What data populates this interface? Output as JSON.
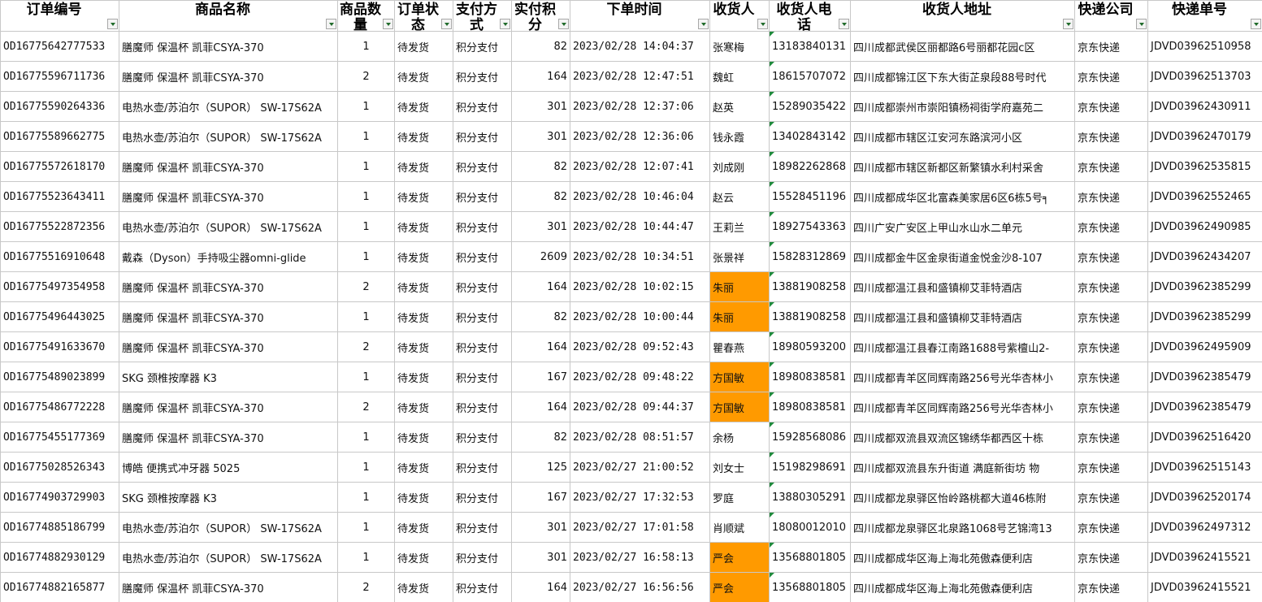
{
  "headers": [
    {
      "label": "订单编号"
    },
    {
      "label": "商品名称"
    },
    {
      "label": "商品数量"
    },
    {
      "label": "订单状态"
    },
    {
      "label": "支付方式"
    },
    {
      "label": "实付积分"
    },
    {
      "label": "下单时间"
    },
    {
      "label": "收货人"
    },
    {
      "label": "收货人电话"
    },
    {
      "label": "收货人地址"
    },
    {
      "label": "快递公司"
    },
    {
      "label": "快递单号"
    }
  ],
  "rows": [
    {
      "order_id": "OD16775642777533",
      "product": "膳魔师 保温杯 凯菲CSYA-370",
      "qty": "1",
      "status": "待发货",
      "pay": "积分支付",
      "points": "82",
      "time": "2023/02/28 14:04:37",
      "name": "张寒梅",
      "phone": "13183840131",
      "addr": "四川成都武侯区丽都路6号丽都花园c区",
      "courier": "京东快递",
      "tracking": "JDVD03962510958",
      "name_highlight": false
    },
    {
      "order_id": "OD16775596711736",
      "product": "膳魔师 保温杯 凯菲CSYA-370",
      "qty": "2",
      "status": "待发货",
      "pay": "积分支付",
      "points": "164",
      "time": "2023/02/28 12:47:51",
      "name": "魏虹",
      "phone": "18615707072",
      "addr": "四川成都锦江区下东大街芷泉段88号时代",
      "courier": "京东快递",
      "tracking": "JDVD03962513703",
      "name_highlight": false
    },
    {
      "order_id": "OD16775590264336",
      "product": "电热水壶/苏泊尔（SUPOR） SW-17S62A",
      "qty": "1",
      "status": "待发货",
      "pay": "积分支付",
      "points": "301",
      "time": "2023/02/28 12:37:06",
      "name": "赵英",
      "phone": "15289035422",
      "addr": "四川成都崇州市崇阳镇杨祠街学府嘉苑二",
      "courier": "京东快递",
      "tracking": "JDVD03962430911",
      "name_highlight": false
    },
    {
      "order_id": "OD16775589662775",
      "product": "电热水壶/苏泊尔（SUPOR） SW-17S62A",
      "qty": "1",
      "status": "待发货",
      "pay": "积分支付",
      "points": "301",
      "time": "2023/02/28 12:36:06",
      "name": "钱永霞",
      "phone": "13402843142",
      "addr": "四川成都市辖区江安河东路滨河小区",
      "courier": "京东快递",
      "tracking": "JDVD03962470179",
      "name_highlight": false
    },
    {
      "order_id": "OD16775572618170",
      "product": "膳魔师 保温杯 凯菲CSYA-370",
      "qty": "1",
      "status": "待发货",
      "pay": "积分支付",
      "points": "82",
      "time": "2023/02/28 12:07:41",
      "name": "刘成刚",
      "phone": "18982262868",
      "addr": "四川成都市辖区新都区新繁镇水利村采舍",
      "courier": "京东快递",
      "tracking": "JDVD03962535815",
      "name_highlight": false
    },
    {
      "order_id": "OD16775523643411",
      "product": "膳魔师 保温杯 凯菲CSYA-370",
      "qty": "1",
      "status": "待发货",
      "pay": "积分支付",
      "points": "82",
      "time": "2023/02/28 10:46:04",
      "name": "赵云",
      "phone": "15528451196",
      "addr": "四川成都成华区北富森美家居6区6栋5号╕",
      "courier": "京东快递",
      "tracking": "JDVD03962552465",
      "name_highlight": false
    },
    {
      "order_id": "OD16775522872356",
      "product": "电热水壶/苏泊尔（SUPOR） SW-17S62A",
      "qty": "1",
      "status": "待发货",
      "pay": "积分支付",
      "points": "301",
      "time": "2023/02/28 10:44:47",
      "name": "王莉兰",
      "phone": "18927543363",
      "addr": "四川广安广安区上甲山水山水二单元",
      "courier": "京东快递",
      "tracking": "JDVD03962490985",
      "name_highlight": false
    },
    {
      "order_id": "OD16775516910648",
      "product": "戴森（Dyson）手持吸尘器omni-glide",
      "qty": "1",
      "status": "待发货",
      "pay": "积分支付",
      "points": "2609",
      "time": "2023/02/28 10:34:51",
      "name": "张景祥",
      "phone": "15828312869",
      "addr": "四川成都金牛区金泉街道金悦金沙8-107",
      "courier": "京东快递",
      "tracking": "JDVD03962434207",
      "name_highlight": false
    },
    {
      "order_id": "OD16775497354958",
      "product": "膳魔师 保温杯 凯菲CSYA-370",
      "qty": "2",
      "status": "待发货",
      "pay": "积分支付",
      "points": "164",
      "time": "2023/02/28 10:02:15",
      "name": "朱丽",
      "phone": "13881908258",
      "addr": "四川成都温江县和盛镇柳艾菲特酒店",
      "courier": "京东快递",
      "tracking": "JDVD03962385299",
      "name_highlight": true
    },
    {
      "order_id": "OD16775496443025",
      "product": "膳魔师 保温杯 凯菲CSYA-370",
      "qty": "1",
      "status": "待发货",
      "pay": "积分支付",
      "points": "82",
      "time": "2023/02/28 10:00:44",
      "name": "朱丽",
      "phone": "13881908258",
      "addr": "四川成都温江县和盛镇柳艾菲特酒店",
      "courier": "京东快递",
      "tracking": "JDVD03962385299",
      "name_highlight": true
    },
    {
      "order_id": "OD16775491633670",
      "product": "膳魔师 保温杯 凯菲CSYA-370",
      "qty": "2",
      "status": "待发货",
      "pay": "积分支付",
      "points": "164",
      "time": "2023/02/28 09:52:43",
      "name": "瞿春燕",
      "phone": "18980593200",
      "addr": "四川成都温江县春江南路1688号紫檀山2-",
      "courier": "京东快递",
      "tracking": "JDVD03962495909",
      "name_highlight": false
    },
    {
      "order_id": "OD16775489023899",
      "product": "SKG 颈椎按摩器 K3",
      "qty": "1",
      "status": "待发货",
      "pay": "积分支付",
      "points": "167",
      "time": "2023/02/28 09:48:22",
      "name": "方国敏",
      "phone": "18980838581",
      "addr": "四川成都青羊区同辉南路256号光华杏林小",
      "courier": "京东快递",
      "tracking": "JDVD03962385479",
      "name_highlight": true
    },
    {
      "order_id": "OD16775486772228",
      "product": "膳魔师 保温杯 凯菲CSYA-370",
      "qty": "2",
      "status": "待发货",
      "pay": "积分支付",
      "points": "164",
      "time": "2023/02/28 09:44:37",
      "name": "方国敏",
      "phone": "18980838581",
      "addr": "四川成都青羊区同辉南路256号光华杏林小",
      "courier": "京东快递",
      "tracking": "JDVD03962385479",
      "name_highlight": true
    },
    {
      "order_id": "OD16775455177369",
      "product": "膳魔师 保温杯 凯菲CSYA-370",
      "qty": "1",
      "status": "待发货",
      "pay": "积分支付",
      "points": "82",
      "time": "2023/02/28 08:51:57",
      "name": "余杨",
      "phone": "15928568086",
      "addr": "四川成都双流县双流区锦绣华都西区十栋",
      "courier": "京东快递",
      "tracking": "JDVD03962516420",
      "name_highlight": false
    },
    {
      "order_id": "OD16775028526343",
      "product": "博皓 便携式冲牙器 5025",
      "qty": "1",
      "status": "待发货",
      "pay": "积分支付",
      "points": "125",
      "time": "2023/02/27 21:00:52",
      "name": "刘女士",
      "phone": "15198298691",
      "addr": "四川成都双流县东升街道 满庭新街坊 物",
      "courier": "京东快递",
      "tracking": "JDVD03962515143",
      "name_highlight": false
    },
    {
      "order_id": "OD16774903729903",
      "product": "SKG 颈椎按摩器 K3",
      "qty": "1",
      "status": "待发货",
      "pay": "积分支付",
      "points": "167",
      "time": "2023/02/27 17:32:53",
      "name": "罗庭",
      "phone": "13880305291",
      "addr": "四川成都龙泉驿区怡岭路桃都大道46栋附",
      "courier": "京东快递",
      "tracking": "JDVD03962520174",
      "name_highlight": false
    },
    {
      "order_id": "OD16774885186799",
      "product": "电热水壶/苏泊尔（SUPOR） SW-17S62A",
      "qty": "1",
      "status": "待发货",
      "pay": "积分支付",
      "points": "301",
      "time": "2023/02/27 17:01:58",
      "name": "肖顺斌",
      "phone": "18080012010",
      "addr": "四川成都龙泉驿区北泉路1068号艺锦湾13",
      "courier": "京东快递",
      "tracking": "JDVD03962497312",
      "name_highlight": false
    },
    {
      "order_id": "OD16774882930129",
      "product": "电热水壶/苏泊尔（SUPOR） SW-17S62A",
      "qty": "1",
      "status": "待发货",
      "pay": "积分支付",
      "points": "301",
      "time": "2023/02/27 16:58:13",
      "name": "严会",
      "phone": "13568801805",
      "addr": "四川成都成华区海上海北苑傲森便利店",
      "courier": "京东快递",
      "tracking": "JDVD03962415521",
      "name_highlight": true
    },
    {
      "order_id": "OD16774882165877",
      "product": "膳魔师 保温杯 凯菲CSYA-370",
      "qty": "2",
      "status": "待发货",
      "pay": "积分支付",
      "points": "164",
      "time": "2023/02/27 16:56:56",
      "name": "严会",
      "phone": "13568801805",
      "addr": "四川成都成华区海上海北苑傲森便利店",
      "courier": "京东快递",
      "tracking": "JDVD03962415521",
      "name_highlight": true
    }
  ]
}
